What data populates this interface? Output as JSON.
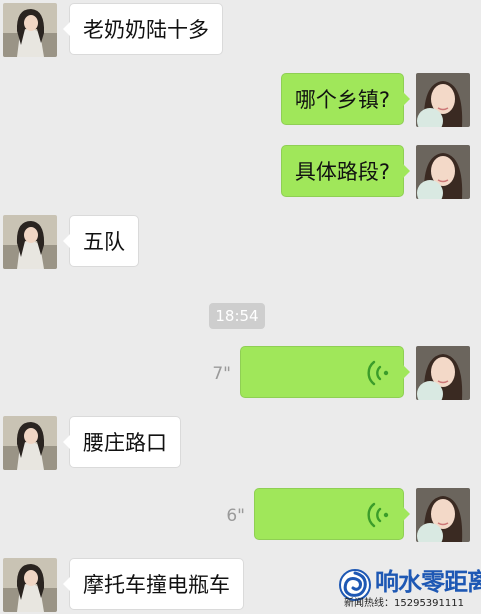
{
  "messages": [
    {
      "side": "in",
      "type": "text",
      "text": "老奶奶陆十多"
    },
    {
      "side": "out",
      "type": "text",
      "text": "哪个乡镇?"
    },
    {
      "side": "out",
      "type": "text",
      "text": "具体路段?"
    },
    {
      "side": "in",
      "type": "text",
      "text": "五队"
    },
    {
      "side": "out",
      "type": "voice",
      "duration": "7\""
    },
    {
      "side": "in",
      "type": "text",
      "text": "腰庄路口"
    },
    {
      "side": "out",
      "type": "voice",
      "duration": "6\""
    },
    {
      "side": "in",
      "type": "text",
      "text": "摩托车撞电瓶车"
    }
  ],
  "timestamp": "18:54",
  "icons": {
    "voice": "voice-wave-icon",
    "watermark_logo": "swirl-logo-icon"
  },
  "watermark": {
    "title": "响水零距离",
    "hotline": "新闻热线：15295391111"
  },
  "colors": {
    "background": "#ebebeb",
    "incoming_bubble": "#ffffff",
    "outgoing_bubble": "#a0e75a",
    "voice_icon": "#3b9c2a",
    "brand_blue": "#1e58b4"
  }
}
